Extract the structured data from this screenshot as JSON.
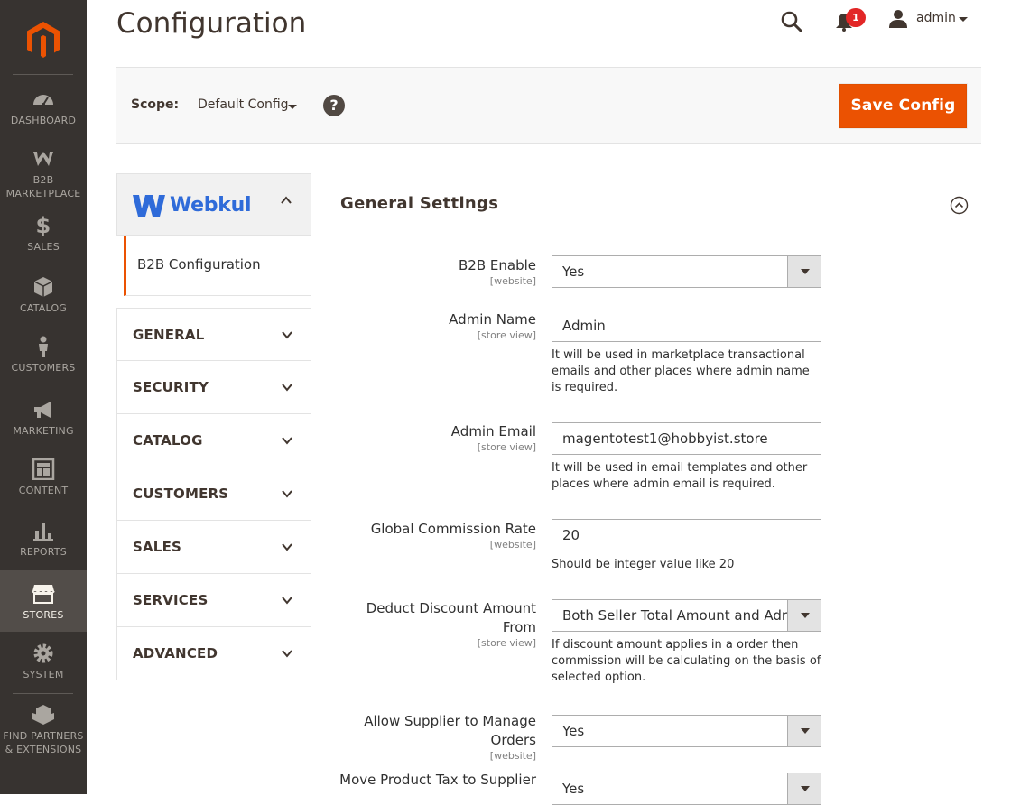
{
  "sidebar": {
    "items": [
      {
        "label": "DASHBOARD",
        "icon": "dashboard-icon"
      },
      {
        "label": "B2B MARKETPLACE",
        "icon": "b2b-marketplace-icon"
      },
      {
        "label": "SALES",
        "icon": "dollar-icon"
      },
      {
        "label": "CATALOG",
        "icon": "box-icon"
      },
      {
        "label": "CUSTOMERS",
        "icon": "person-icon"
      },
      {
        "label": "MARKETING",
        "icon": "megaphone-icon"
      },
      {
        "label": "CONTENT",
        "icon": "layout-icon"
      },
      {
        "label": "REPORTS",
        "icon": "bar-chart-icon"
      },
      {
        "label": "STORES",
        "icon": "store-icon",
        "active": true
      },
      {
        "label": "SYSTEM",
        "icon": "gear-icon"
      },
      {
        "label": "FIND PARTNERS & EXTENSIONS",
        "icon": "boxes-icon"
      }
    ]
  },
  "header": {
    "title": "Configuration",
    "notification_count": "1",
    "user": "admin"
  },
  "scope": {
    "label": "Scope:",
    "value": "Default Config",
    "save_label": "Save Config"
  },
  "tabs": {
    "brand": "Webkul",
    "sub_item": "B2B Configuration",
    "items": [
      "GENERAL",
      "SECURITY",
      "CATALOG",
      "CUSTOMERS",
      "SALES",
      "SERVICES",
      "ADVANCED"
    ]
  },
  "section": {
    "title": "General Settings",
    "rows": [
      {
        "label": "B2B Enable",
        "scope": "[website]",
        "value": "Yes",
        "type": "select",
        "note": ""
      },
      {
        "label": "Admin Name",
        "scope": "[store view]",
        "value": "Admin",
        "type": "text",
        "note": "It will be used in marketplace transactional emails and other places where admin name is required."
      },
      {
        "label": "Admin Email",
        "scope": "[store view]",
        "value": "magentotest1@hobbyist.store",
        "type": "text",
        "note": "It will be used in email templates and other places where admin email is required."
      },
      {
        "label": "Global Commission Rate",
        "scope": "[website]",
        "value": "20",
        "type": "text",
        "note": "Should be integer value like 20"
      },
      {
        "label": "Deduct Discount Amount From",
        "scope": "[store view]",
        "value": "Both Seller Total Amount and Adr",
        "type": "select",
        "note": "If discount amount applies in a order then commission will be calculating on the basis of selected option."
      },
      {
        "label": "Allow Supplier to Manage Orders",
        "scope": "[website]",
        "value": "Yes",
        "type": "select",
        "note": ""
      },
      {
        "label": "Move Product Tax to Supplier",
        "scope": "",
        "value": "Yes",
        "type": "select",
        "note": ""
      }
    ]
  },
  "colors": {
    "sidebar_bg": "#373330",
    "accent": "#eb5202",
    "brand_blue": "#2f6bd9"
  }
}
